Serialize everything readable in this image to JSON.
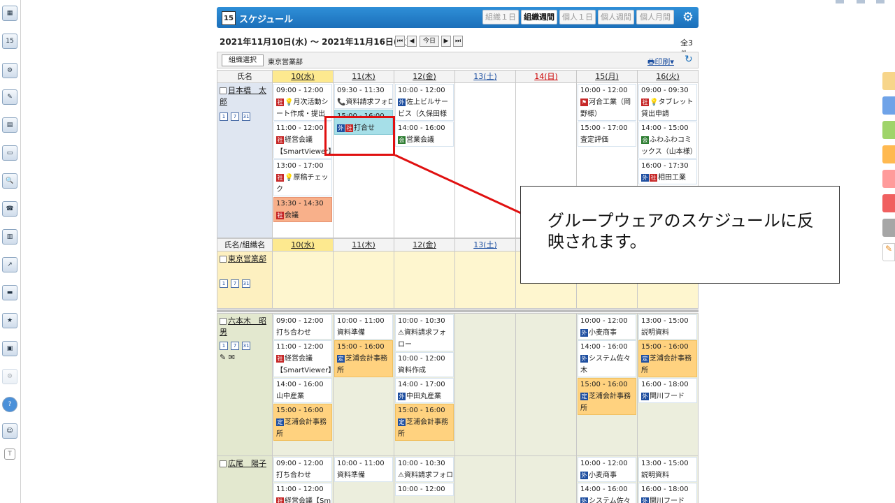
{
  "app": {
    "title": "スケジュール",
    "calendar_icon_day": "15"
  },
  "views": [
    "組織１日",
    "組織週間",
    "個人１日",
    "個人週間",
    "個人月間"
  ],
  "active_view": "組織週間",
  "range": "2021年11月10日(水) ～ 2021年11月16日(火)",
  "nav": {
    "first": "⏮",
    "prev": "◀",
    "today": "今日",
    "next": "▶",
    "last": "⏭"
  },
  "total": "全3件",
  "toolbar": {
    "org_select": "組織選択",
    "org_name": "東京営業部",
    "print": "印刷▾"
  },
  "header1": {
    "name_col": "氏名",
    "days": [
      "10(水)",
      "11(木)",
      "12(金)",
      "13(土)",
      "14(日)",
      "15(月)",
      "16(火)"
    ]
  },
  "header2": {
    "name_col": "氏名/組織名",
    "days": [
      "10(水)",
      "11(木)",
      "12(金)",
      "13(土)"
    ]
  },
  "org_row": {
    "name": "東京営業部"
  },
  "persons": [
    {
      "name": "日本橋　太郎",
      "days": [
        [
          {
            "t": "09:00 - 12:00",
            "d": "💡月次活動シート作成・提出"
          },
          {
            "t": "11:00 - 12:00",
            "d": "経営会議【SmartViewer】"
          },
          {
            "t": "13:00 - 17:00",
            "d": "💡原稿チェック"
          },
          {
            "t": "13:30 - 14:30",
            "d": "会議"
          }
        ],
        [
          {
            "t": "09:30 - 11:30",
            "d": "📞資料請求フォロー"
          },
          {
            "t": "15:00 - 16:00",
            "d": "打合せ"
          }
        ],
        [
          {
            "t": "10:00 - 12:00",
            "d": "佐上ビルサービス（久保田様"
          },
          {
            "t": "14:00 - 16:00",
            "d": "営業会議"
          }
        ],
        [],
        [],
        [
          {
            "t": "10:00 - 12:00",
            "d": "河合工業（岡野様）"
          },
          {
            "t": "15:00 - 17:00",
            "d": "査定評価"
          }
        ],
        [
          {
            "t": "09:00 - 09:30",
            "d": "💡タブレット貸出申請"
          },
          {
            "t": "14:00 - 15:00",
            "d": "ふわふわコミックス（山本様）"
          },
          {
            "t": "16:00 - 17:30",
            "d": "相田工業"
          }
        ]
      ]
    },
    {
      "name": "六本木　昭男",
      "days": [
        [
          {
            "t": "09:00 - 12:00",
            "d": "打ち合わせ"
          },
          {
            "t": "11:00 - 12:00",
            "d": "経営会議【SmartViewer】"
          },
          {
            "t": "14:00 - 16:00",
            "d": "山中産業"
          },
          {
            "t": "15:00 - 16:00",
            "d": "芝浦会計事務所"
          }
        ],
        [
          {
            "t": "10:00 - 11:00",
            "d": "資料準備"
          },
          {
            "t": "15:00 - 16:00",
            "d": "芝浦会計事務所"
          }
        ],
        [
          {
            "t": "10:00 - 10:30",
            "d": "資料請求フォロー"
          },
          {
            "t": "10:00 - 12:00",
            "d": "資料作成"
          },
          {
            "t": "14:00 - 17:00",
            "d": "中田丸産業"
          },
          {
            "t": "15:00 - 16:00",
            "d": "芝浦会計事務所"
          }
        ],
        [],
        [],
        [
          {
            "t": "10:00 - 12:00",
            "d": "小麦商事"
          },
          {
            "t": "14:00 - 16:00",
            "d": "システム佐々木"
          },
          {
            "t": "15:00 - 16:00",
            "d": "芝浦会計事務所"
          }
        ],
        [
          {
            "t": "13:00 - 15:00",
            "d": "説明資料"
          },
          {
            "t": "15:00 - 16:00",
            "d": "芝浦会計事務所"
          },
          {
            "t": "16:00 - 18:00",
            "d": "関川フード"
          }
        ]
      ]
    },
    {
      "name": "広尾　陽子",
      "days": [
        [
          {
            "t": "09:00 - 12:00",
            "d": "打ち合わせ"
          },
          {
            "t": "11:00 - 12:00",
            "d": "経営会議【Sm"
          }
        ],
        [
          {
            "t": "10:00 - 11:00",
            "d": "資料準備"
          }
        ],
        [
          {
            "t": "10:00 - 10:30",
            "d": "資料請求フォロー"
          },
          {
            "t": "10:00 - 12:00",
            "d": ""
          }
        ],
        [],
        [],
        [
          {
            "t": "10:00 - 12:00",
            "d": "小麦商事"
          },
          {
            "t": "14:00 - 16:00",
            "d": "システム佐々"
          }
        ],
        [
          {
            "t": "13:00 - 15:00",
            "d": "説明資料"
          },
          {
            "t": "16:00 - 18:00",
            "d": "関川フード"
          }
        ]
      ]
    }
  ],
  "mini_icons": [
    "1",
    "7",
    "31"
  ],
  "callout": "グループウェアのスケジュールに反映されます。",
  "colors": {
    "header_blue": "#1b6fba",
    "today_col": "#fde98f",
    "highlight_red": "#e01010",
    "event_orange": "#ffd27f"
  }
}
